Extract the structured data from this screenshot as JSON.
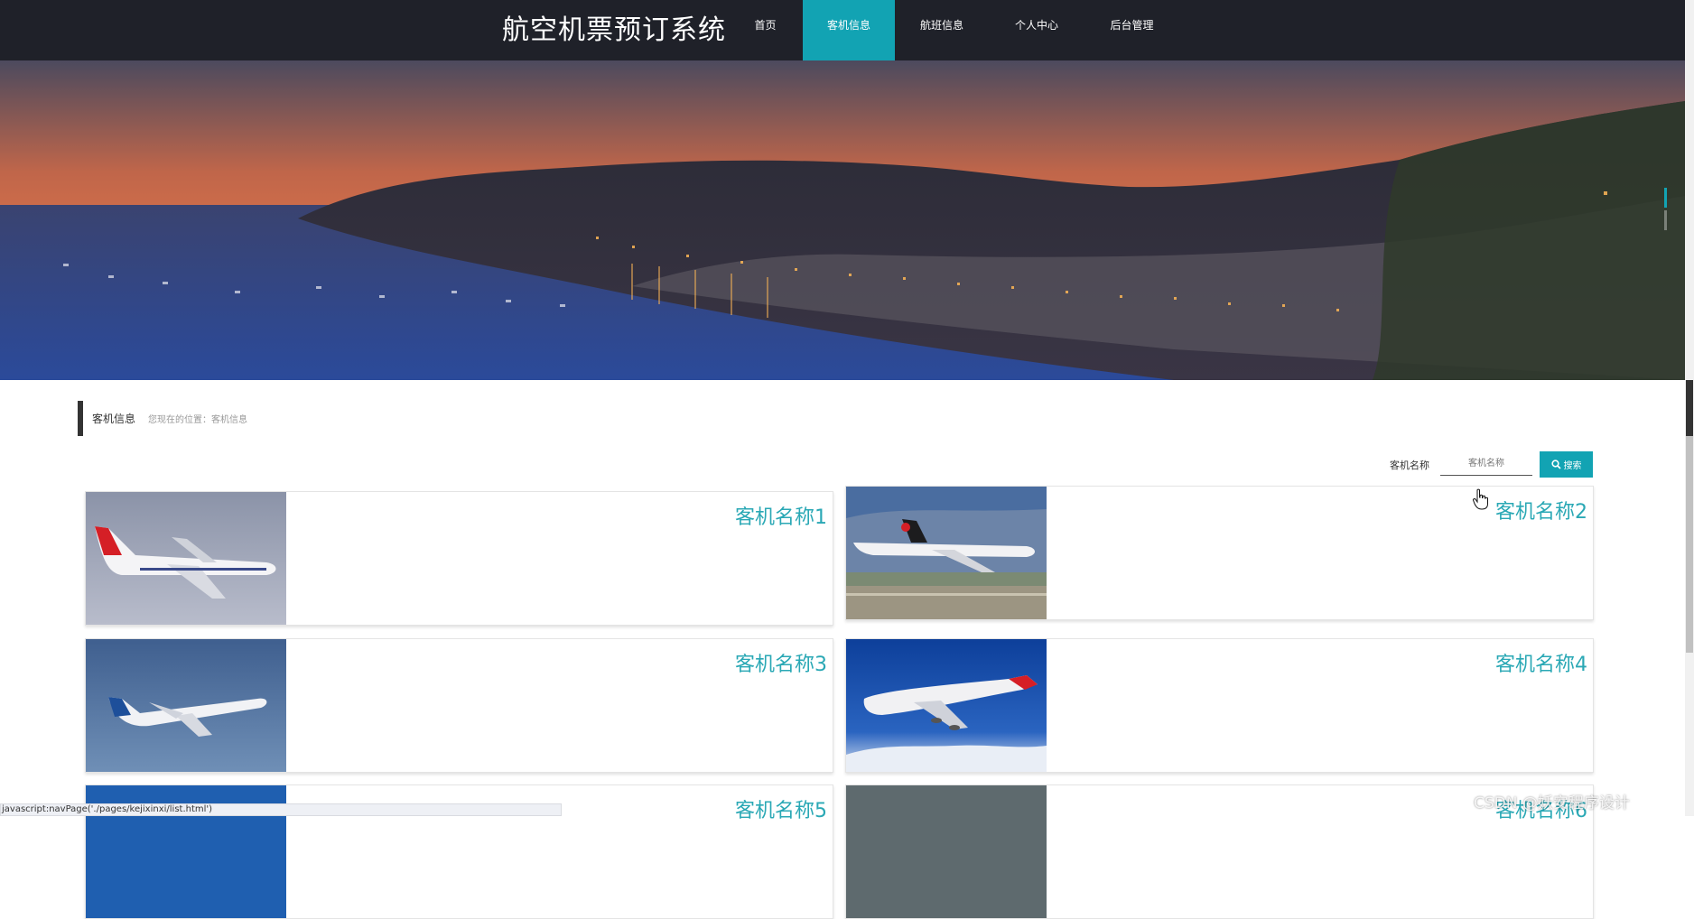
{
  "header": {
    "title": "航空机票预订系统",
    "nav": [
      {
        "label": "首页",
        "active": false
      },
      {
        "label": "客机信息",
        "active": true
      },
      {
        "label": "航班信息",
        "active": false
      },
      {
        "label": "个人中心",
        "active": false
      },
      {
        "label": "后台管理",
        "active": false
      }
    ]
  },
  "breadcrumb": {
    "title": "客机信息",
    "location": "您现在的位置：客机信息"
  },
  "search": {
    "label": "客机名称",
    "placeholder": "客机名称",
    "button": "搜索"
  },
  "cards": [
    {
      "title": "客机名称1"
    },
    {
      "title": "客机名称2"
    },
    {
      "title": "客机名称3"
    },
    {
      "title": "客机名称4"
    },
    {
      "title": "客机名称5"
    },
    {
      "title": "客机名称6"
    }
  ],
  "status_bar": {
    "text": "javascript:navPage('./pages/kejixinxi/list.html')"
  },
  "watermark": "CSDN @妖安程序设计",
  "colors": {
    "accent": "#12a3b3",
    "header_bg": "#1f2129",
    "card_title": "#2aa8b5"
  }
}
